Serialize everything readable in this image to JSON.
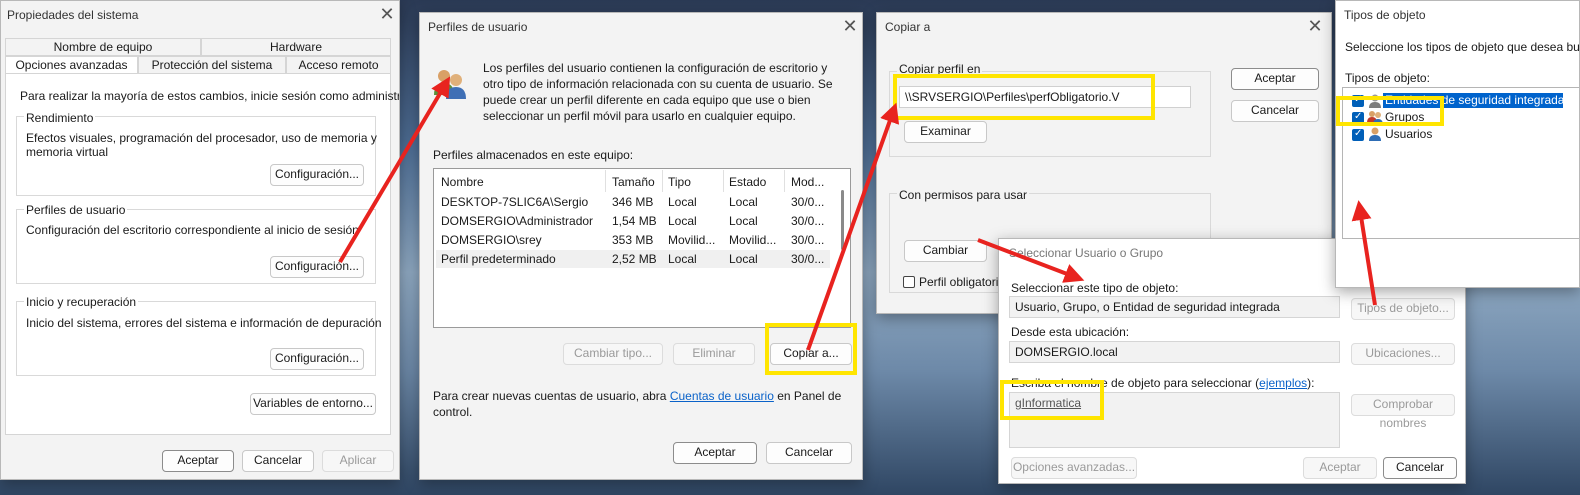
{
  "sys_props": {
    "title": "Propiedades del sistema",
    "tabs_row1": [
      "Nombre de equipo",
      "Hardware"
    ],
    "tabs_row2": [
      "Opciones avanzadas",
      "Protección del sistema",
      "Acceso remoto"
    ],
    "admin_note": "Para realizar la mayoría de estos cambios, inicie sesión como administrador.",
    "perf": {
      "title": "Rendimiento",
      "desc1": "Efectos visuales, programación del procesador, uso de memoria y",
      "desc2": "memoria virtual",
      "button": "Configuración..."
    },
    "profiles": {
      "title": "Perfiles de usuario",
      "desc": "Configuración del escritorio correspondiente al inicio de sesión",
      "button": "Configuración..."
    },
    "startup": {
      "title": "Inicio y recuperación",
      "desc": "Inicio del sistema, errores del sistema e información de depuración",
      "button": "Configuración..."
    },
    "env_button": "Variables de entorno...",
    "ok": "Aceptar",
    "cancel": "Cancelar",
    "apply": "Aplicar"
  },
  "user_profiles": {
    "title": "Perfiles de usuario",
    "intro1": "Los perfiles del usuario contienen la configuración de escritorio y",
    "intro2": "otro tipo de información relacionada con su cuenta de usuario. Se",
    "intro3": "puede crear un perfil diferente en cada equipo que use o bien",
    "intro4": "seleccionar un perfil móvil para usarlo en cualquier equipo.",
    "stored_label": "Perfiles almacenados en este equipo:",
    "columns": [
      "Nombre",
      "Tamaño",
      "Tipo",
      "Estado",
      "Mod..."
    ],
    "rows": [
      [
        "DESKTOP-7SLIC6A\\Sergio",
        "346 MB",
        "Local",
        "Local",
        "30/0..."
      ],
      [
        "DOMSERGIO\\Administrador",
        "1,54 MB",
        "Local",
        "Local",
        "30/0..."
      ],
      [
        "DOMSERGIO\\srey",
        "353 MB",
        "Movilid...",
        "Movilid...",
        "30/0..."
      ],
      [
        "Perfil predeterminado",
        "2,52 MB",
        "Local",
        "Local",
        "30/0..."
      ]
    ],
    "change_type": "Cambiar tipo...",
    "delete": "Eliminar",
    "copy_to": "Copiar a...",
    "footer_before": "Para crear nuevas cuentas de usuario, abra ",
    "footer_link": "Cuentas de usuario",
    "footer_after": " en Panel de",
    "footer_line2": "control.",
    "ok": "Aceptar",
    "cancel": "Cancelar"
  },
  "copy_to": {
    "title": "Copiar a",
    "copy_profile_label": "Copiar perfil en",
    "path_value": "\\\\SRVSERGIO\\Perfiles\\perfObligatorio.V",
    "browse": "Examinar",
    "perm_label": "Con permisos para usar",
    "change": "Cambiar",
    "mandatory": "Perfil obligatorio",
    "ok": "Aceptar",
    "cancel": "Cancelar"
  },
  "select_user": {
    "title": "Seleccionar Usuario o Grupo",
    "type_label": "Seleccionar este tipo de objeto:",
    "type_value": "Usuario, Grupo, o Entidad de seguridad integrada",
    "types_button": "Tipos de objeto...",
    "location_label": "Desde esta ubicación:",
    "location_value": "DOMSERGIO.local",
    "locations_button": "Ubicaciones...",
    "name_label": "Escriba el nombre de objeto para seleccionar (",
    "name_link": "ejemplos",
    "name_label_end": "):",
    "name_value": "gInformatica",
    "check_names": "Comprobar nombres",
    "advanced": "Opciones avanzadas...",
    "ok": "Aceptar",
    "cancel": "Cancelar"
  },
  "object_types": {
    "title": "Tipos de objeto",
    "desc": "Seleccione los tipos de objeto que desea busca",
    "list_label": "Tipos de objeto:",
    "items": [
      "Entidades de seguridad integradas",
      "Grupos",
      "Usuarios"
    ]
  },
  "colors": {
    "highlight": "#ffe500",
    "arrow": "#e8231f",
    "selection": "#0063cc",
    "link": "#0a62c9"
  }
}
